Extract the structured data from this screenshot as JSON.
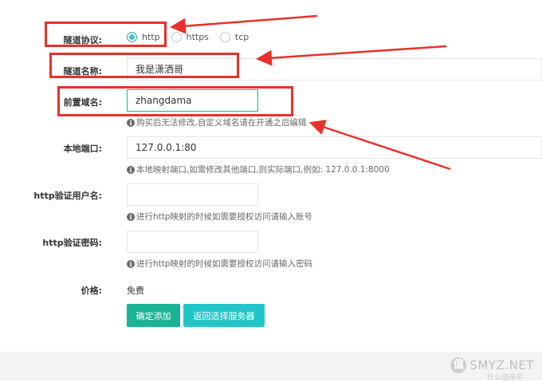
{
  "form": {
    "protocol": {
      "label": "隧道协议:",
      "options": [
        "http",
        "https",
        "tcp"
      ],
      "selected": "http"
    },
    "tunnel_name": {
      "label": "隧道名称:",
      "value": "我是潇洒哥"
    },
    "prefix_domain": {
      "label": "前置域名:",
      "value": "zhangdama",
      "hint": "购买后无法修改,自定义域名请在开通之后编辑"
    },
    "local_port": {
      "label": "本地端口:",
      "value": "127.0.0.1:80",
      "hint": "本地映射端口,如需修改其他端口,则实际端口,例如: 127.0.0.1:8000"
    },
    "http_user": {
      "label": "http验证用户名:",
      "value": "",
      "hint": "进行http映射的时候如需要授权访问请输入账号"
    },
    "http_password": {
      "label": "http验证密码:",
      "value": "",
      "hint": "进行http映射的时候如需要授权访问请输入密码"
    },
    "price": {
      "label": "价格:",
      "value": "免费"
    }
  },
  "buttons": {
    "confirm": "确定添加",
    "back": "返回选择服务器"
  },
  "watermark": {
    "logo": "值",
    "text": "SMYZ.NET",
    "sub": "什么值得买"
  },
  "colors": {
    "primary": "#1ab394",
    "info": "#23c6c8",
    "annotation": "#e8312b",
    "radio_checked": "#55b7d8"
  }
}
